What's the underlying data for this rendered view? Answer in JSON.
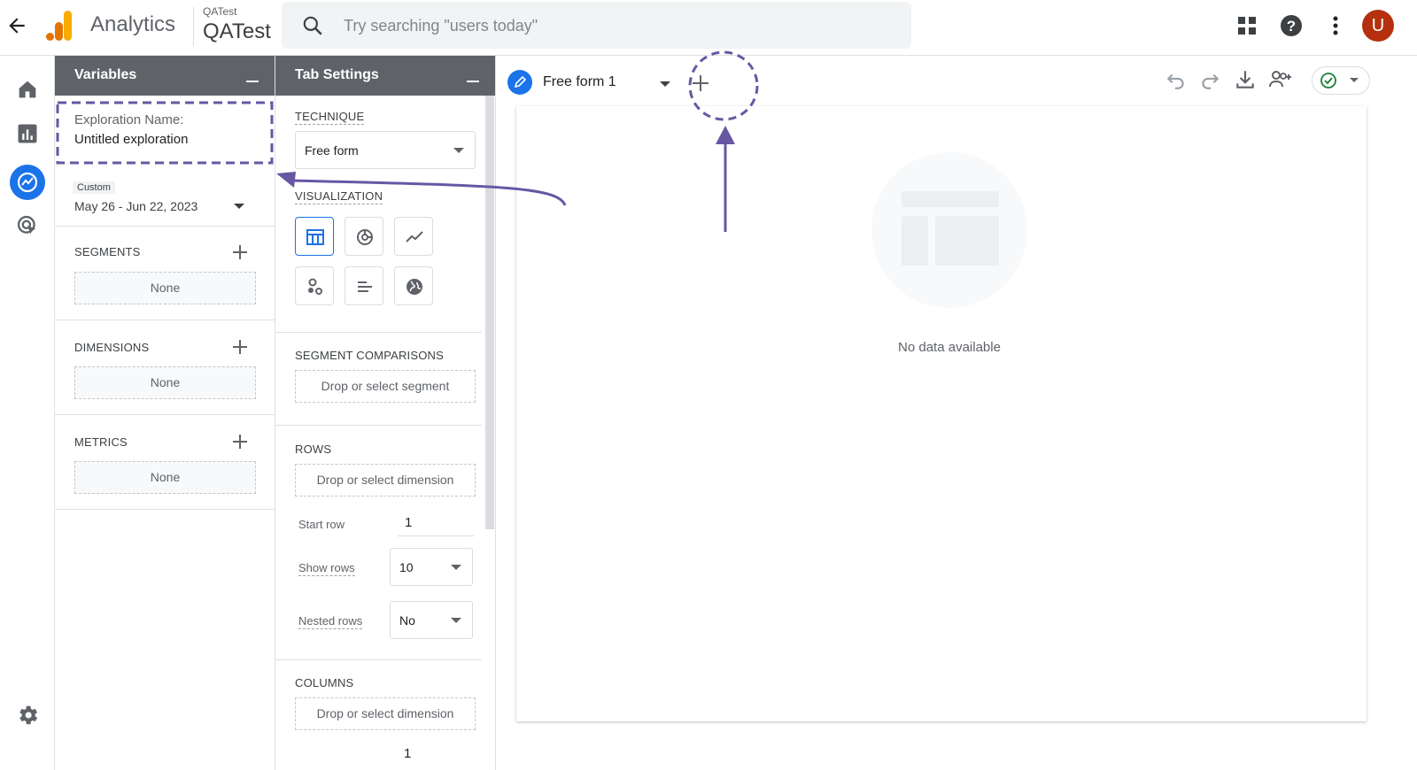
{
  "app": {
    "name": "Analytics",
    "account_small": "QATest",
    "account_big": "QATest"
  },
  "search": {
    "placeholder": "Try searching \"users today\""
  },
  "user": {
    "initial": "U"
  },
  "variables": {
    "title": "Variables",
    "exploration_label": "Exploration Name:",
    "exploration_value": "Untitled exploration",
    "date_badge": "Custom",
    "date_range": "May 26 - Jun 22, 2023",
    "segments_title": "SEGMENTS",
    "segments_value": "None",
    "dimensions_title": "DIMENSIONS",
    "dimensions_value": "None",
    "metrics_title": "METRICS",
    "metrics_value": "None"
  },
  "tab_settings": {
    "title": "Tab Settings",
    "technique_title": "TECHNIQUE",
    "technique_value": "Free form",
    "visualization_title": "VISUALIZATION",
    "segment_comparisons_title": "SEGMENT COMPARISONS",
    "segment_placeholder": "Drop or select segment",
    "rows_title": "ROWS",
    "rows_placeholder": "Drop or select dimension",
    "start_row_label": "Start row",
    "start_row_value": "1",
    "show_rows_label": "Show rows",
    "show_rows_value": "10",
    "nested_rows_label": "Nested rows",
    "nested_rows_value": "No",
    "columns_title": "COLUMNS",
    "columns_placeholder": "Drop or select dimension",
    "start_col_value": "1"
  },
  "canvas": {
    "tab_label": "Free form 1",
    "empty_message": "No data available"
  },
  "icons": {
    "back": "arrow-left-icon",
    "search": "search-icon",
    "apps": "apps-grid-icon",
    "help": "help-icon",
    "more": "more-vert-icon",
    "home": "home-icon",
    "reports": "bar-chart-icon",
    "explore": "explore-icon",
    "advertising": "target-cursor-icon",
    "settings": "gear-icon"
  },
  "colors": {
    "accent": "#1a73e8",
    "avatar": "#b4300e",
    "annotation": "#6757a3",
    "panel_header": "#5f6368"
  }
}
